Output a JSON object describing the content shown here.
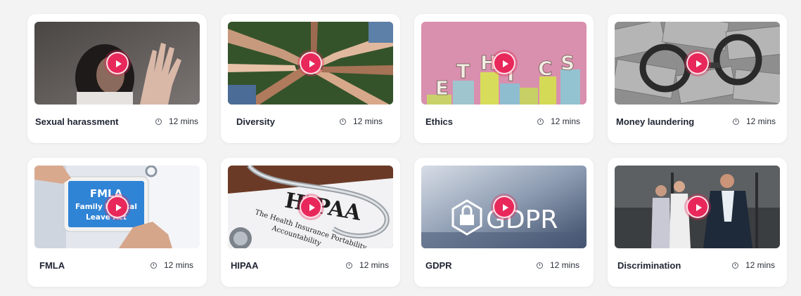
{
  "colors": {
    "accent": "#e8285a",
    "background": "#f3f3f4",
    "card": "#ffffff",
    "title": "#1f2433"
  },
  "icons": {
    "play": "play-icon",
    "duration": "clock-icon"
  },
  "courses": [
    {
      "title": "Sexual harassment",
      "duration": "12 mins"
    },
    {
      "title": "Diversity",
      "duration": "12 mins"
    },
    {
      "title": "Ethics",
      "duration": "12 mins"
    },
    {
      "title": "Money laundering",
      "duration": "12 mins"
    },
    {
      "title": "FMLA",
      "duration": "12 mins"
    },
    {
      "title": "HIPAA",
      "duration": "12 mins"
    },
    {
      "title": "GDPR",
      "duration": "12 mins"
    },
    {
      "title": "Discrimination",
      "duration": "12 mins"
    }
  ],
  "thumbnail_text": {
    "ethics": [
      "E",
      "T",
      "H",
      "I",
      "C",
      "S"
    ],
    "fmla": [
      "FMLA",
      "Family Medical",
      "Leave Act"
    ],
    "hipaa": [
      "HIPAA",
      "The Health Insurance Portability",
      "Accountability"
    ],
    "gdpr": "GDPR"
  }
}
